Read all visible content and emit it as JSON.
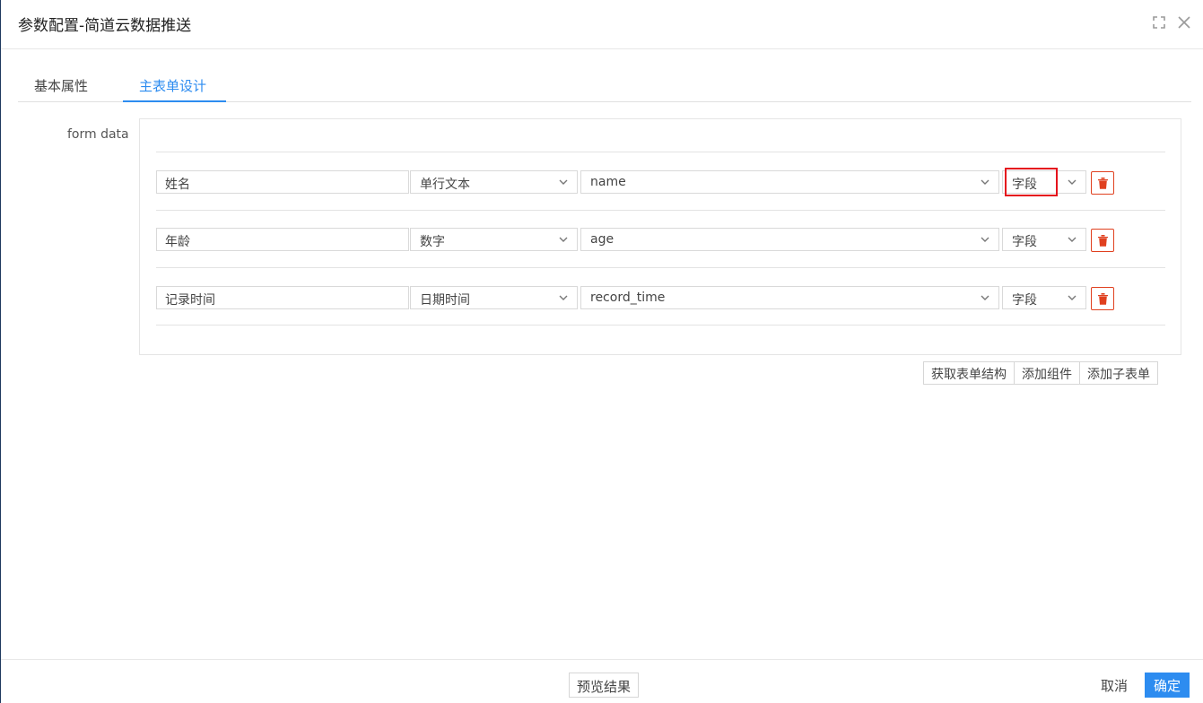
{
  "dialog": {
    "title": "参数配置-简道云数据推送"
  },
  "tabs": [
    {
      "label": "基本属性",
      "active": false
    },
    {
      "label": "主表单设计",
      "active": true
    }
  ],
  "form": {
    "label": "form data",
    "rows": [
      {
        "name": "姓名",
        "type": "单行文本",
        "field": "name",
        "kind": "字段"
      },
      {
        "name": "年龄",
        "type": "数字",
        "field": "age",
        "kind": "字段"
      },
      {
        "name": "记录时间",
        "type": "日期时间",
        "field": "record_time",
        "kind": "字段"
      }
    ]
  },
  "actions": {
    "fetch_structure": "获取表单结构",
    "add_component": "添加组件",
    "add_subform": "添加子表单"
  },
  "footer": {
    "preview": "预览结果",
    "cancel": "取消",
    "confirm": "确定"
  },
  "colors": {
    "accent": "#2d8cf0",
    "danger": "#e0401f",
    "highlight": "#e5131d"
  }
}
